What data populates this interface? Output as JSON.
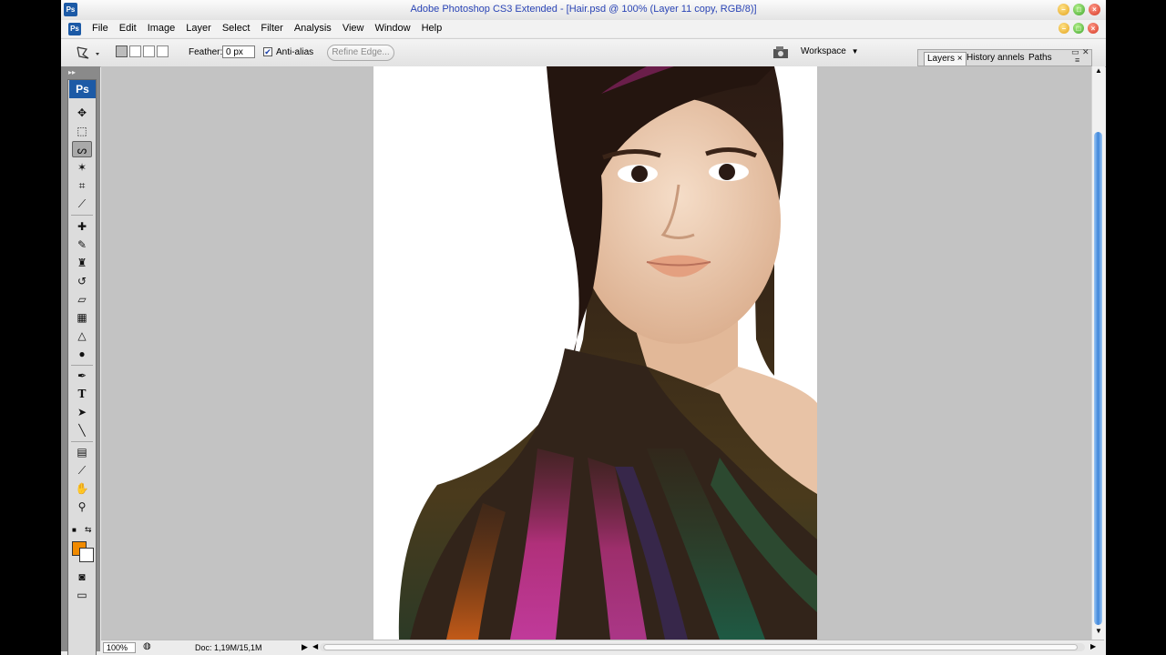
{
  "window": {
    "title": "Adobe Photoshop CS3 Extended - [Hair.psd @ 100% (Layer 11 copy, RGB/8)]",
    "app_badge": "Ps"
  },
  "menu": [
    "File",
    "Edit",
    "Image",
    "Layer",
    "Select",
    "Filter",
    "Analysis",
    "View",
    "Window",
    "Help"
  ],
  "options": {
    "feather_label": "Feather:",
    "feather_value": "0 px",
    "antialias_label": "Anti-alias",
    "antialias_checked": "✔",
    "refine_edge": "Refine Edge...",
    "workspace": "Workspace"
  },
  "panel": {
    "tabs": [
      "Layers",
      "History",
      "annels",
      "Paths"
    ],
    "tab_close": "×"
  },
  "toolbox": {
    "badge": "Ps",
    "tools": [
      {
        "name": "move-tool",
        "glyph": "✥"
      },
      {
        "name": "marquee-tool",
        "glyph": "⬚"
      },
      {
        "name": "lasso-tool",
        "glyph": "ᔕ"
      },
      {
        "name": "magic-wand-tool",
        "glyph": "✶"
      },
      {
        "name": "crop-tool",
        "glyph": "⌗"
      },
      {
        "name": "slice-tool",
        "glyph": "⟋"
      },
      {
        "name": "healing-brush-tool",
        "glyph": "✚"
      },
      {
        "name": "brush-tool",
        "glyph": "✎"
      },
      {
        "name": "clone-stamp-tool",
        "glyph": "♜"
      },
      {
        "name": "history-brush-tool",
        "glyph": "↺"
      },
      {
        "name": "eraser-tool",
        "glyph": "▱"
      },
      {
        "name": "gradient-tool",
        "glyph": "▦"
      },
      {
        "name": "blur-tool",
        "glyph": "△"
      },
      {
        "name": "dodge-tool",
        "glyph": "●"
      },
      {
        "name": "pen-tool",
        "glyph": "✒"
      },
      {
        "name": "type-tool",
        "glyph": "T"
      },
      {
        "name": "path-selection-tool",
        "glyph": "➤"
      },
      {
        "name": "line-tool",
        "glyph": "╲"
      },
      {
        "name": "notes-tool",
        "glyph": "▤"
      },
      {
        "name": "eyedropper-tool",
        "glyph": "⟋"
      },
      {
        "name": "hand-tool",
        "glyph": "✋"
      },
      {
        "name": "zoom-tool",
        "glyph": "⚲"
      }
    ],
    "colors": {
      "foreground": "#f08a00",
      "background": "#ffffff"
    }
  },
  "status": {
    "zoom": "100%",
    "doc": "Doc: 1,19M/15,1M"
  }
}
